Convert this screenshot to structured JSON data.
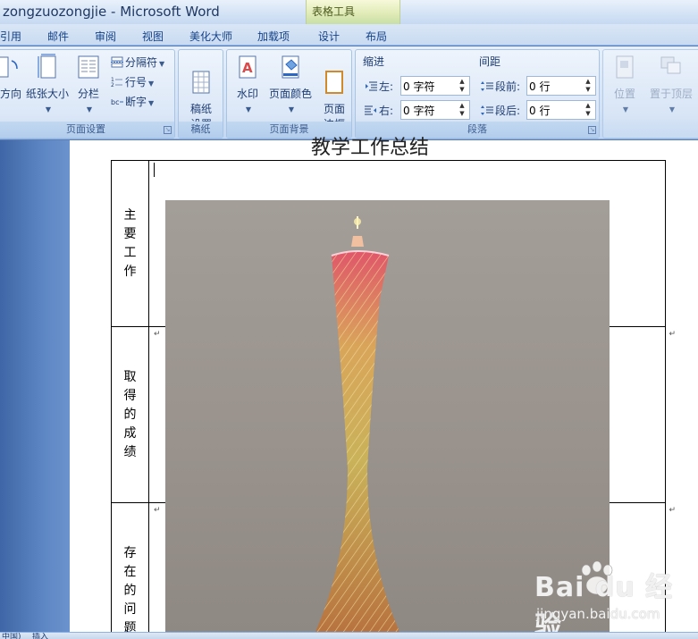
{
  "window": {
    "title": "zongzuozongjie - Microsoft Word",
    "context_tab_group": "表格工具"
  },
  "tabs": [
    "引用",
    "邮件",
    "审阅",
    "视图",
    "美化大师",
    "加载项",
    "设计",
    "布局"
  ],
  "ribbon": {
    "page_setup": {
      "label": "页面设置",
      "orientation": "方向",
      "size": "纸张大小",
      "columns": "分栏",
      "breaks": "分隔符",
      "line_numbers": "行号",
      "hyphenation": "断字"
    },
    "manuscript": {
      "label": "稿纸",
      "button": "稿纸\n设置"
    },
    "page_background": {
      "label": "页面背景",
      "watermark": "水印",
      "page_color": "页面颜色",
      "page_borders": "页面\n边框"
    },
    "paragraph": {
      "label": "段落",
      "indent_title": "缩进",
      "spacing_title": "间距",
      "indent_left_label": "左:",
      "indent_left_value": "0 字符",
      "indent_right_label": "右:",
      "indent_right_value": "0 字符",
      "spacing_before_label": "段前:",
      "spacing_before_value": "0 行",
      "spacing_after_label": "段后:",
      "spacing_after_value": "0 行"
    },
    "arrange": {
      "position": "位置",
      "bring_front": "置于顶层"
    }
  },
  "document": {
    "title": "教学工作总结",
    "rows": [
      {
        "label": "主要工作"
      },
      {
        "label": "取得的成绩"
      },
      {
        "label": "存在的问题"
      }
    ]
  },
  "status": {
    "left": "中国)",
    "mode": "插入"
  },
  "watermark": {
    "brand": "Bai du 经验",
    "site": "jingyan.baidu.com"
  },
  "colors": {
    "ribbon_bg": "#d2e1f4",
    "context_tab": "#e1ebb8",
    "text_blue": "#15428b"
  }
}
